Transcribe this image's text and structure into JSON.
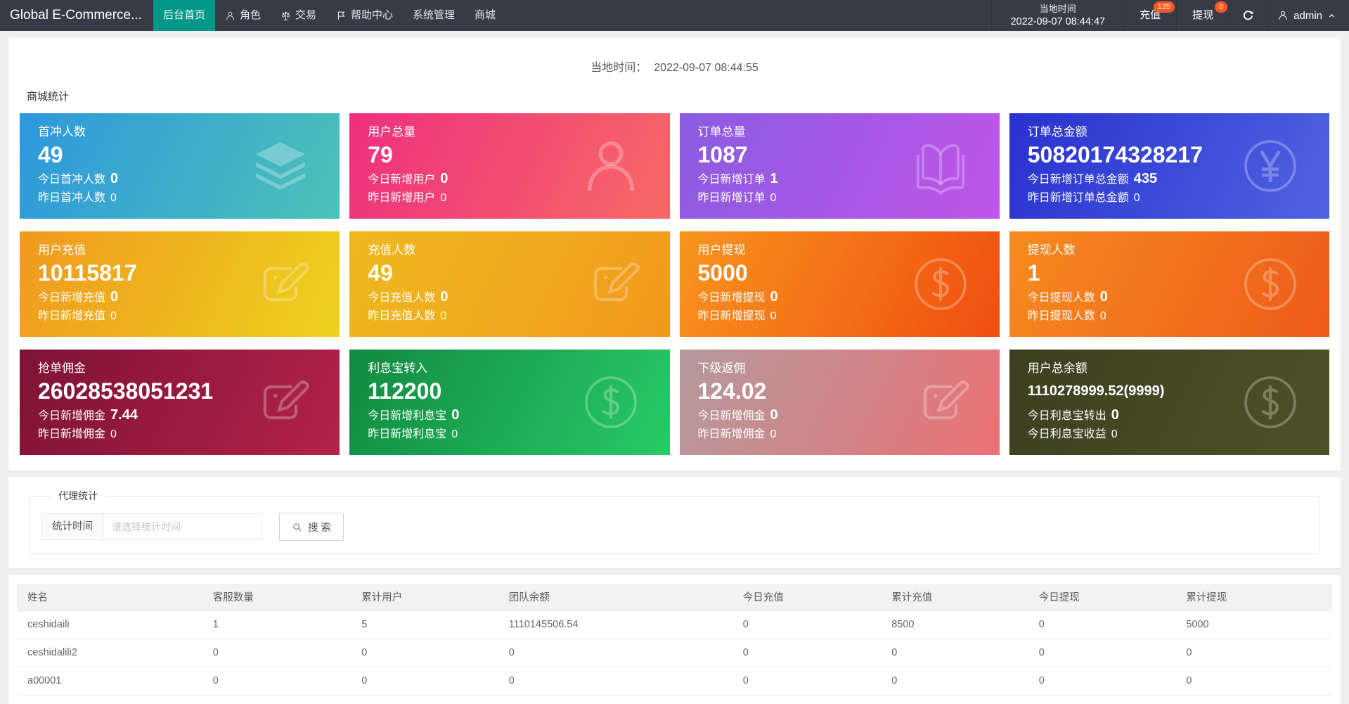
{
  "navbar": {
    "brand": "Global E-Commerce...",
    "items": [
      {
        "label": "后台首页",
        "active": true
      },
      {
        "label": "角色",
        "icon": "person"
      },
      {
        "label": "交易",
        "icon": "scales"
      },
      {
        "label": "帮助中心",
        "icon": "flag"
      },
      {
        "label": "系统管理"
      },
      {
        "label": "商城"
      }
    ],
    "local_time_label": "当地时间",
    "local_time_value": "2022-09-07 08:44:47",
    "recharge": {
      "label": "充值",
      "badge": "135"
    },
    "withdraw": {
      "label": "提现",
      "badge": "0"
    },
    "username": "admin",
    "badge_color": "#FF5722",
    "active_color": "#009688"
  },
  "stats": {
    "local_time_label": "当地时间：",
    "local_time_value": "2022-09-07 08:44:55",
    "section_title": "商城统计",
    "cards": [
      {
        "title": "首冲人数",
        "value": "49",
        "line2_label": "今日首冲人数",
        "line2_value": "0",
        "line3_label": "昨日首冲人数",
        "line3_value": "0",
        "icon": "layers",
        "color_from": "#2f97dd",
        "color_to": "#4cc2b8"
      },
      {
        "title": "用户总量",
        "value": "79",
        "line2_label": "今日新增用户",
        "line2_value": "0",
        "line3_label": "昨日新增用户",
        "line3_value": "0",
        "icon": "person",
        "color_from": "#ee2f7e",
        "color_to": "#f76a66"
      },
      {
        "title": "订单总量",
        "value": "1087",
        "line2_label": "今日新增订单",
        "line2_value": "1",
        "line3_label": "昨日新增订单",
        "line3_value": "0",
        "icon": "book",
        "color_from": "#8a5ce0",
        "color_to": "#c055e9"
      },
      {
        "title": "订单总金额",
        "value": "50820174328217",
        "line2_label": "今日新增订单总金额",
        "line2_value": "435",
        "line3_label": "昨日新增订单总金额",
        "line3_value": "0",
        "icon": "yen",
        "color_from": "#2832cd",
        "color_to": "#5063e2"
      },
      {
        "title": "用户充值",
        "value": "10115817",
        "line2_label": "今日新增充值",
        "line2_value": "0",
        "line3_label": "昨日新增充值",
        "line3_value": "0",
        "icon": "edit",
        "color_from": "#f0991f",
        "color_to": "#edd21e"
      },
      {
        "title": "充值人数",
        "value": "49",
        "line2_label": "今日充值人数",
        "line2_value": "0",
        "line3_label": "昨日充值人数",
        "line3_value": "0",
        "icon": "edit",
        "color_from": "#eeb91e",
        "color_to": "#f2991e"
      },
      {
        "title": "用户提现",
        "value": "5000",
        "line2_label": "今日新增提现",
        "line2_value": "0",
        "line3_label": "昨日新增提现",
        "line3_value": "0",
        "icon": "dollar",
        "color_from": "#f8941e",
        "color_to": "#ef4e10"
      },
      {
        "title": "提现人数",
        "value": "1",
        "line2_label": "今日提现人数",
        "line2_value": "0",
        "line3_label": "昨日提现人数",
        "line3_value": "0",
        "icon": "dollar",
        "color_from": "#f68b1f",
        "color_to": "#ee5b1a"
      },
      {
        "title": "抢单佣金",
        "value": "26028538051231",
        "line2_label": "今日新增佣金",
        "line2_value": "7.44",
        "line3_label": "昨日新增佣金",
        "line3_value": "0",
        "icon": "edit",
        "color_from": "#7e1236",
        "color_to": "#b22347"
      },
      {
        "title": "利息宝转入",
        "value": "112200",
        "line2_label": "今日新增利息宝",
        "line2_value": "0",
        "line3_label": "昨日新增利息宝",
        "line3_value": "0",
        "icon": "dollar",
        "color_from": "#118a41",
        "color_to": "#28ca67"
      },
      {
        "title": "下级返佣",
        "value": "124.02",
        "line2_label": "今日新增佣金",
        "line2_value": "0",
        "line3_label": "昨日新增佣金",
        "line3_value": "0",
        "icon": "edit",
        "color_from": "#b39a9c",
        "color_to": "#eb7175"
      },
      {
        "title": "用户总余额",
        "value": "1110278999.52(9999)",
        "small_value": true,
        "line2_label": "今日利息宝转出",
        "line2_value": "0",
        "line3_label": "今日利息宝收益",
        "line3_value": "0",
        "icon": "dollar",
        "color_from": "#3d4020",
        "color_to": "#4d5026"
      }
    ]
  },
  "agent": {
    "legend": "代理统计",
    "field_label": "统计时间",
    "placeholder": "请选择统计时间",
    "search_label": "搜 索"
  },
  "table": {
    "headers": [
      "姓名",
      "客服数量",
      "累计用户",
      "团队余额",
      "今日充值",
      "累计充值",
      "今日提现",
      "累计提现"
    ],
    "rows": [
      [
        "ceshidaili",
        "1",
        "5",
        "1110145506.54",
        "0",
        "8500",
        "0",
        "5000"
      ],
      [
        "ceshidalili2",
        "0",
        "0",
        "0",
        "0",
        "0",
        "0",
        "0"
      ],
      [
        "a00001",
        "0",
        "0",
        "0",
        "0",
        "0",
        "0",
        "0"
      ]
    ]
  }
}
